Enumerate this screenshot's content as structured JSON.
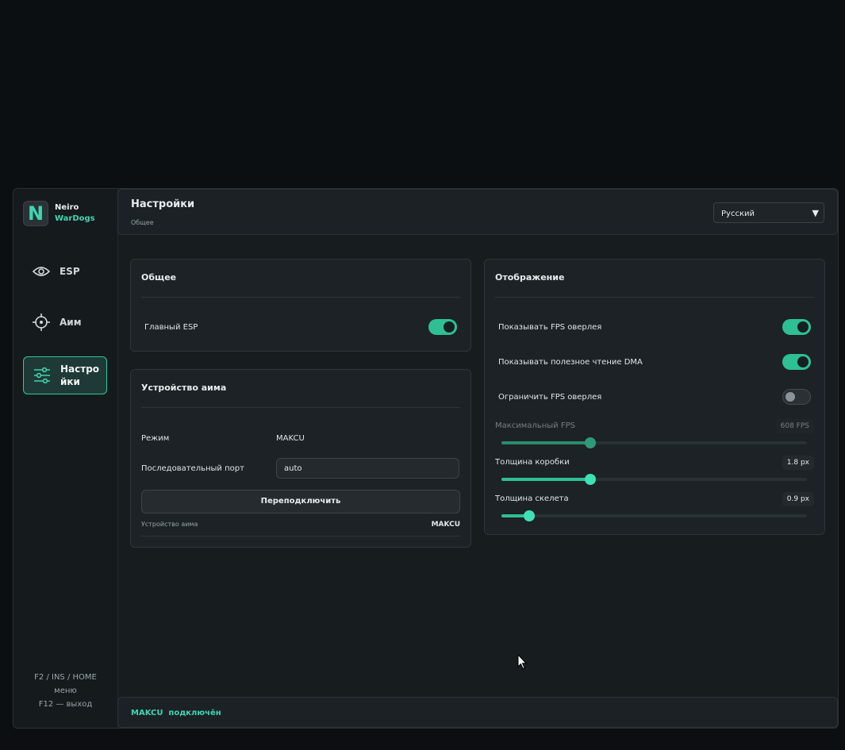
{
  "brand": {
    "line1": "Neiro",
    "line2": "WarDogs",
    "logo_letter": "N"
  },
  "sidebar": {
    "items": [
      {
        "label": "ESP",
        "icon": "eye-icon"
      },
      {
        "label": "Аим",
        "icon": "crosshair-icon"
      },
      {
        "label": "Настро\nйки",
        "icon": "sliders-icon",
        "active": true
      }
    ],
    "footer": {
      "line1": "F2 / INS / HOME",
      "line2": "меню",
      "line3": "F12 — выход"
    }
  },
  "header": {
    "title": "Настройки",
    "subtitle": "Общее",
    "language": "Русский"
  },
  "general": {
    "title": "Общее",
    "main_esp_label": "Главный ESP",
    "main_esp_on": true
  },
  "aim_device": {
    "title": "Устройство аима",
    "mode_label": "Режим",
    "mode_value": "MAKCU",
    "port_label": "Последовательный порт",
    "port_value": "auto",
    "reconnect_label": "Переподключить",
    "device_label": "Устройство аима",
    "device_value": "MAKCU"
  },
  "display": {
    "title": "Отображение",
    "toggles": [
      {
        "label": "Показывать FPS оверлея",
        "on": true
      },
      {
        "label": "Показывать полезное чтение DMA",
        "on": true
      },
      {
        "label": "Ограничить FPS оверлея",
        "on": false
      }
    ],
    "sliders": [
      {
        "label": "Максимальный FPS",
        "value_text": "608 FPS",
        "fraction": 0.29,
        "disabled": true
      },
      {
        "label": "Толщина коробки",
        "value_text": "1.8 px",
        "fraction": 0.29,
        "disabled": false
      },
      {
        "label": "Толщина скелета",
        "value_text": "0.9 px",
        "fraction": 0.09,
        "disabled": false
      }
    ]
  },
  "footer": {
    "status": "MAKCU  подключён"
  },
  "colors": {
    "accent": "#2fbf95",
    "background": "#0c0f11",
    "panel": "#1c2225"
  }
}
